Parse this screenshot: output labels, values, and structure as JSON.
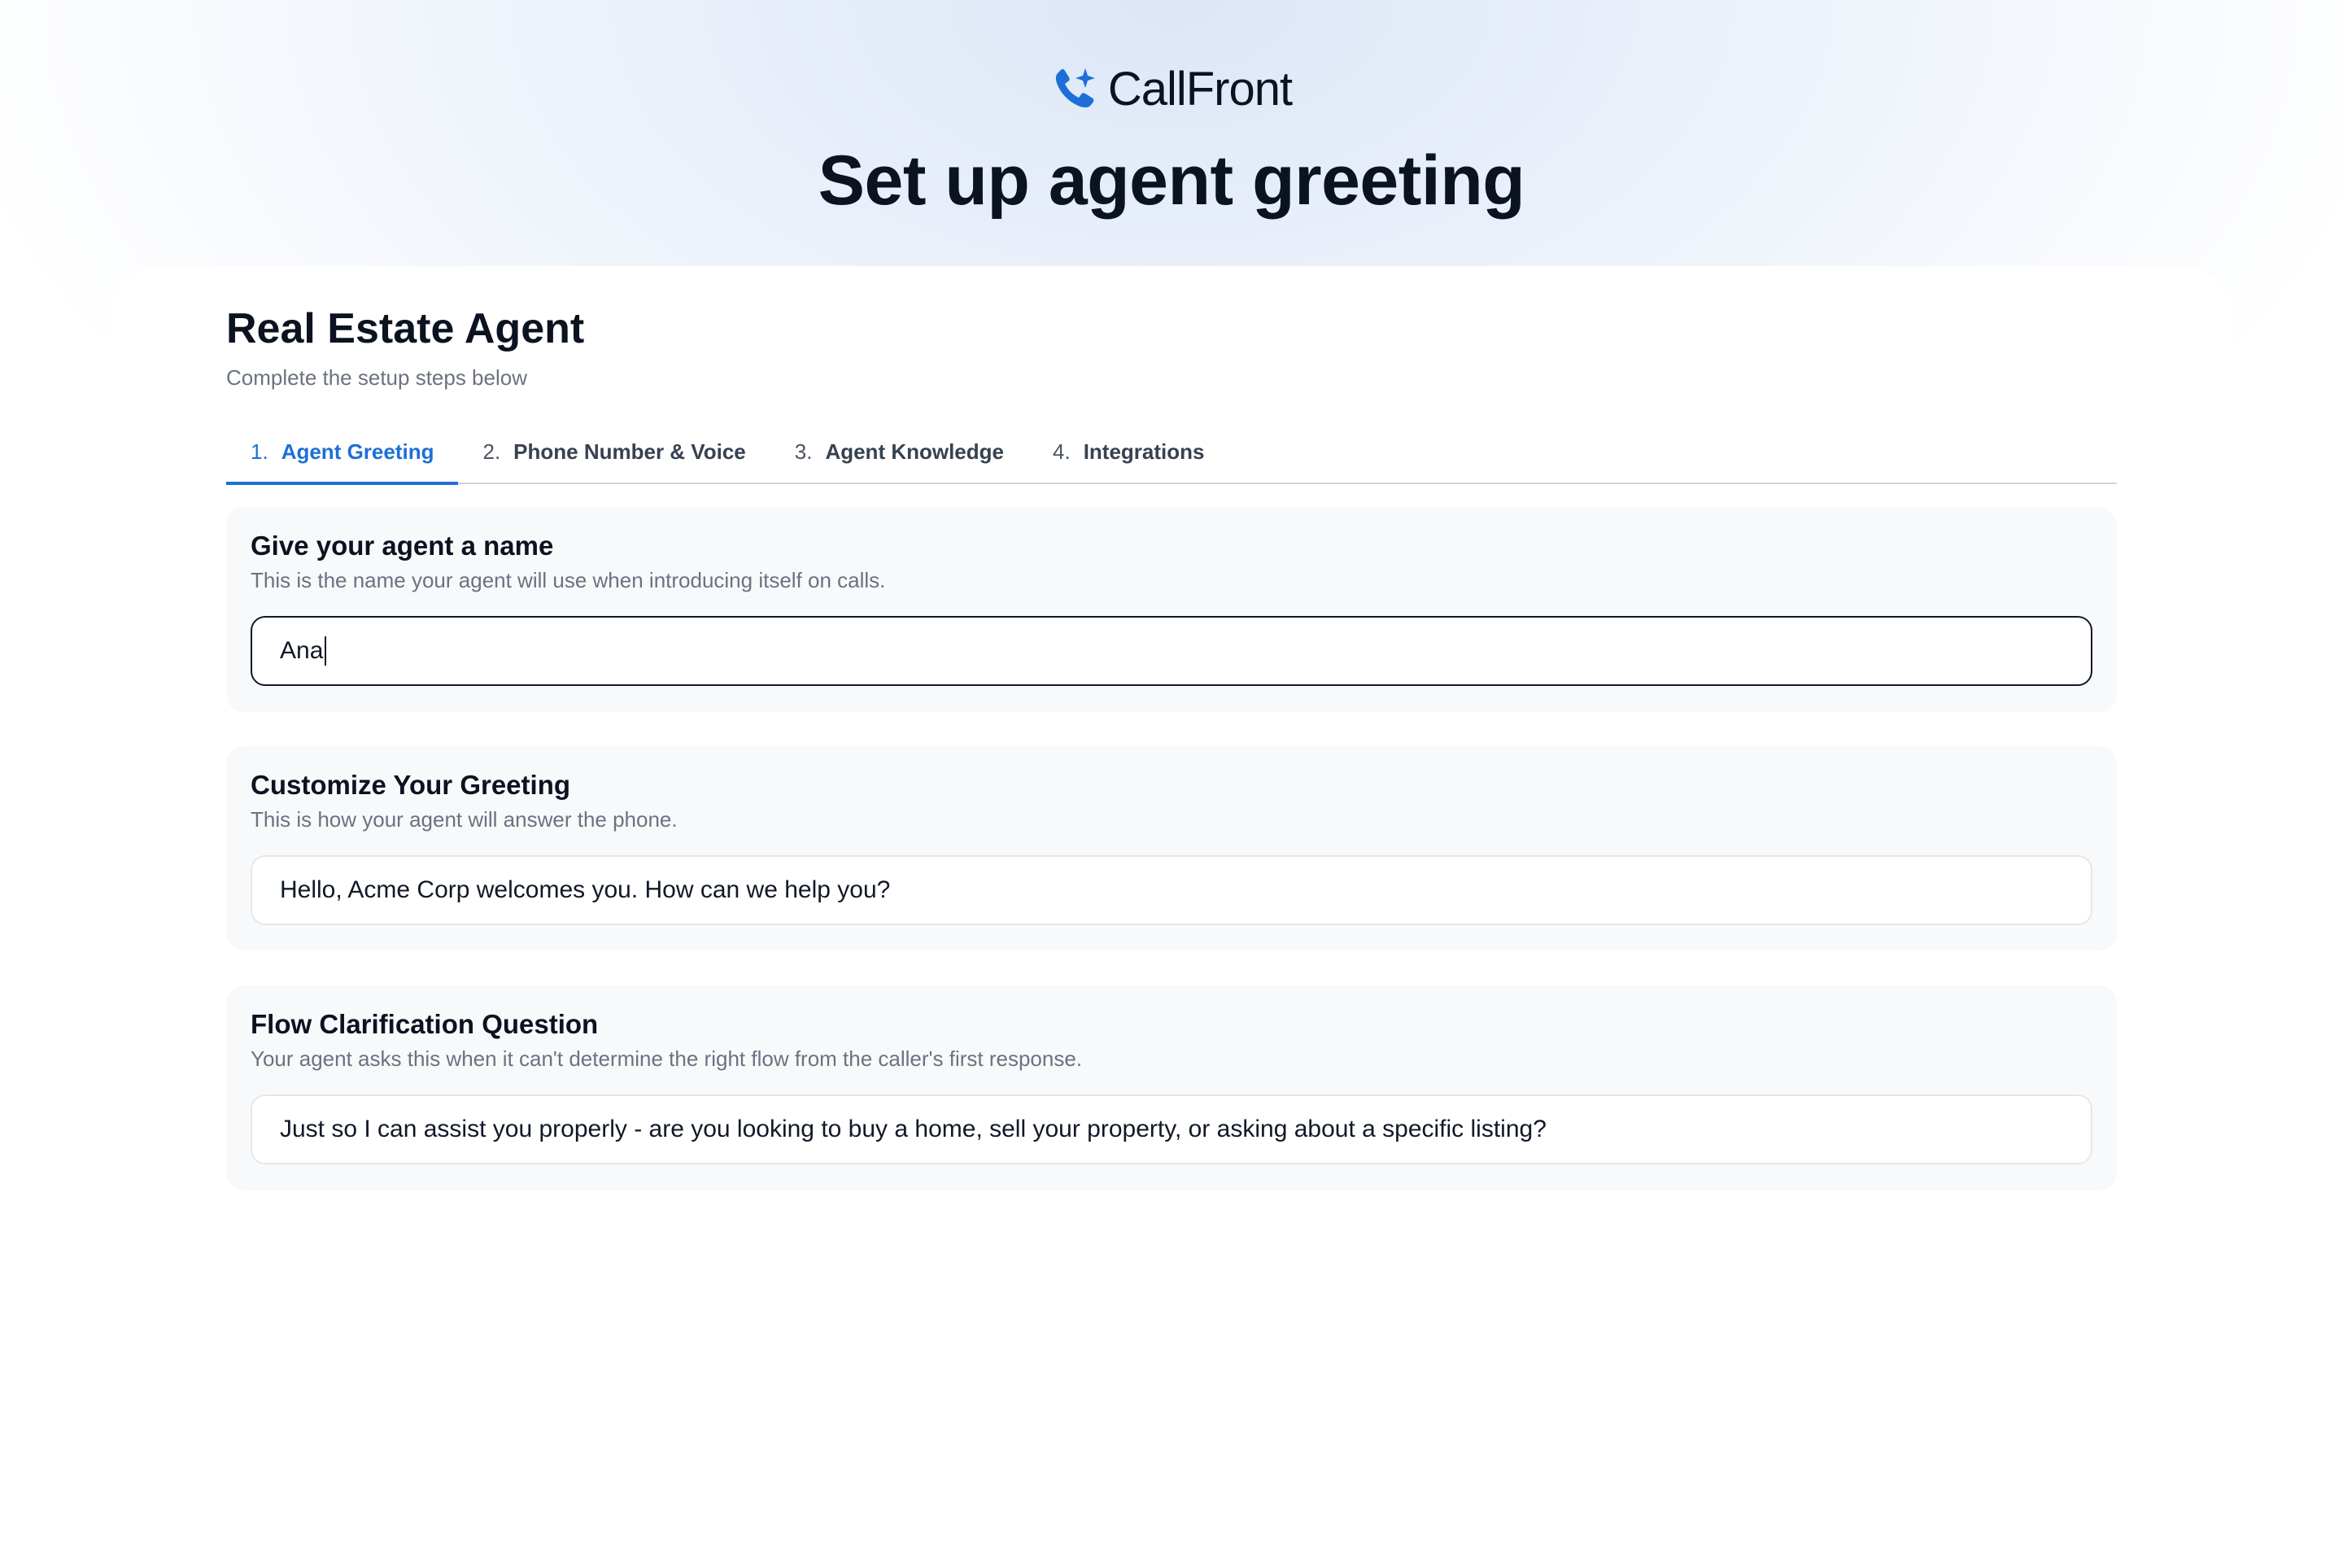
{
  "brand": {
    "name": "CallFront",
    "icon": "phone-sparkle-icon",
    "accent_color": "#1d6fd8"
  },
  "page": {
    "title": "Set up agent greeting"
  },
  "agent": {
    "title": "Real Estate Agent",
    "subtitle": "Complete the setup steps below"
  },
  "tabs": [
    {
      "number": "1.",
      "label": "Agent Greeting",
      "active": true
    },
    {
      "number": "2.",
      "label": "Phone Number & Voice",
      "active": false
    },
    {
      "number": "3.",
      "label": "Agent Knowledge",
      "active": false
    },
    {
      "number": "4.",
      "label": "Integrations",
      "active": false
    }
  ],
  "sections": {
    "name": {
      "title": "Give your agent a name",
      "description": "This is the name your agent will use when introducing itself on calls.",
      "value": "Ana"
    },
    "greeting": {
      "title": "Customize Your Greeting",
      "description": "This is how your agent will answer the phone.",
      "value": "Hello, Acme Corp welcomes you. How can we help you?"
    },
    "clarification": {
      "title": "Flow Clarification Question",
      "description": "Your agent asks this when it can't determine the right flow from the caller's first response.",
      "value": "Just so I can assist you properly - are you looking to buy a home, sell your property, or asking about a specific listing?"
    }
  }
}
